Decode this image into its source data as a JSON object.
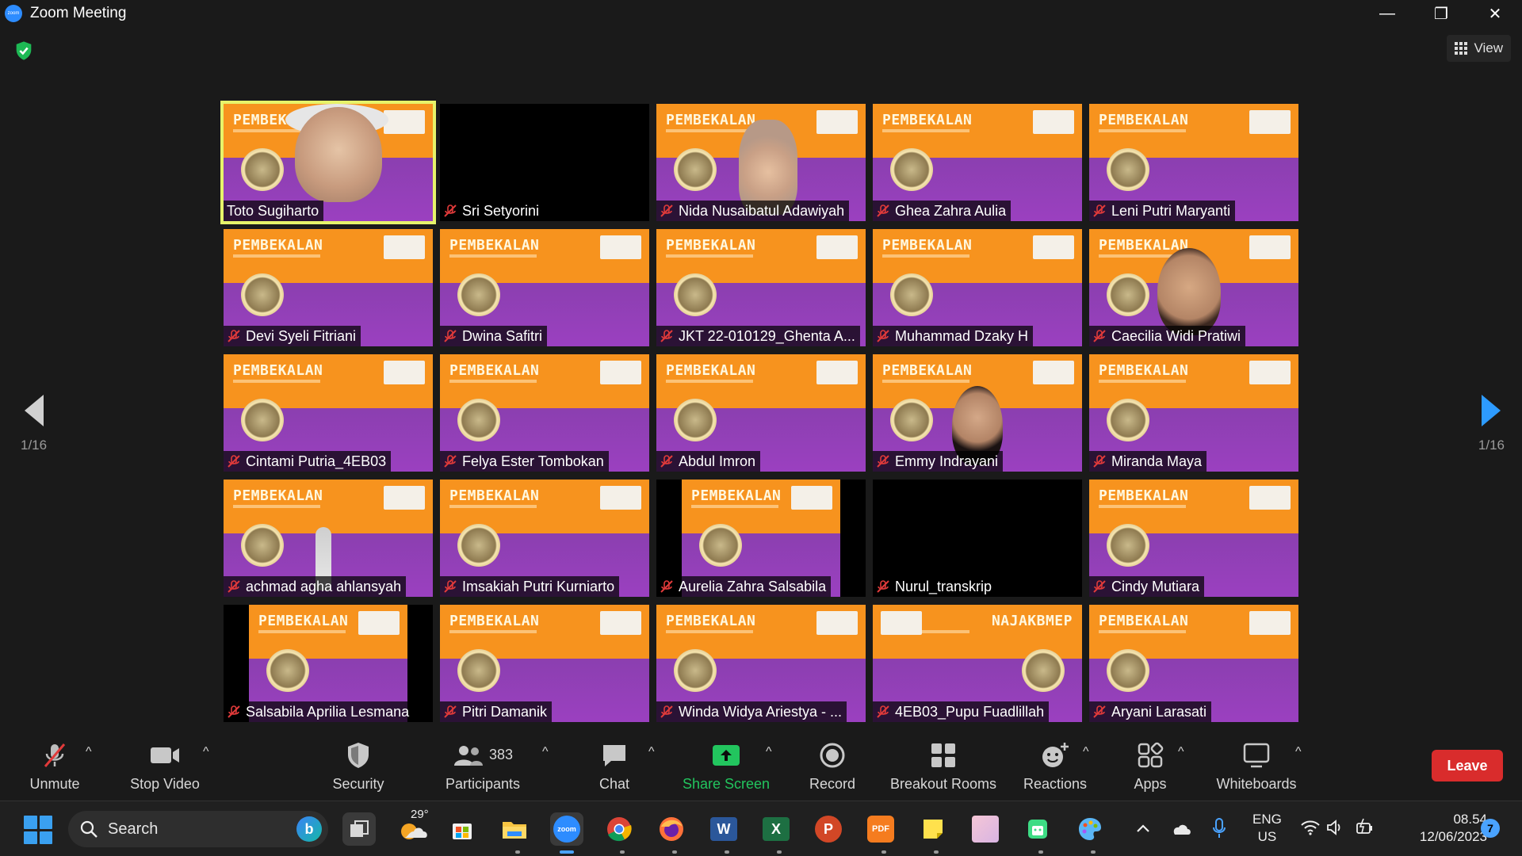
{
  "window": {
    "title": "Zoom Meeting",
    "logo_text": "zoom",
    "minimize": "—",
    "restore": "❐",
    "close": "✕"
  },
  "top": {
    "view_label": "View"
  },
  "slide": {
    "title": "PEMBEKALAN",
    "title_mirrored": "NAJAKBMEP"
  },
  "participants_grid": [
    {
      "name": "Toto Sugiharto",
      "muted": false
    },
    {
      "name": "Sri Setyorini",
      "muted": true
    },
    {
      "name": "Nida Nusaibatul Adawiyah",
      "muted": true
    },
    {
      "name": "Ghea Zahra Aulia",
      "muted": true
    },
    {
      "name": "Leni Putri Maryanti",
      "muted": true
    },
    {
      "name": "Devi Syeli Fitriani",
      "muted": true
    },
    {
      "name": "Dwina Safitri",
      "muted": true
    },
    {
      "name": "JKT 22-010129_Ghenta A...",
      "muted": true
    },
    {
      "name": "Muhammad Dzaky H",
      "muted": true
    },
    {
      "name": "Caecilia Widi Pratiwi",
      "muted": true
    },
    {
      "name": "Cintami Putria_4EB03",
      "muted": true
    },
    {
      "name": "Felya Ester Tombokan",
      "muted": true
    },
    {
      "name": "Abdul Imron",
      "muted": true
    },
    {
      "name": "Emmy Indrayani",
      "muted": true
    },
    {
      "name": "Miranda Maya",
      "muted": true
    },
    {
      "name": "achmad agha ahlansyah",
      "muted": true
    },
    {
      "name": "Imsakiah Putri Kurniarto",
      "muted": true
    },
    {
      "name": "Aurelia Zahra Salsabila",
      "muted": true
    },
    {
      "name": "Nurul_transkrip",
      "muted": true
    },
    {
      "name": "Cindy Mutiara",
      "muted": true
    },
    {
      "name": "Salsabila Aprilia Lesmana",
      "muted": true
    },
    {
      "name": "Pitri Damanik",
      "muted": true
    },
    {
      "name": "Winda Widya Ariestya - ...",
      "muted": true
    },
    {
      "name": "4EB03_Pupu Fuadlillah",
      "muted": true
    },
    {
      "name": "Aryani Larasati",
      "muted": true
    }
  ],
  "pagination": {
    "left_label": "1/16",
    "right_label": "1/16"
  },
  "toolbar": {
    "unmute": "Unmute",
    "stop_video": "Stop Video",
    "security": "Security",
    "participants": "Participants",
    "participants_count": "383",
    "chat": "Chat",
    "share_screen": "Share Screen",
    "record": "Record",
    "breakout_rooms": "Breakout Rooms",
    "reactions": "Reactions",
    "apps": "Apps",
    "whiteboards": "Whiteboards",
    "leave": "Leave",
    "caret": "^"
  },
  "taskbar": {
    "search_label": "Search",
    "bing_label": "b",
    "weather_temp": "29°",
    "zoom_label": "zoom",
    "word_label": "W",
    "excel_label": "X",
    "ppt_label": "P",
    "pdf_label": "PDF",
    "lang_line1": "ENG",
    "lang_line2": "US",
    "time": "08.54",
    "date": "12/06/2023",
    "notification_count": "7"
  },
  "colors": {
    "active_speaker_border": "#e7f36a",
    "share_green": "#22c55e",
    "leave_red": "#d92c2c",
    "muted_red": "#e03a3a",
    "slide_orange": "#f7931e",
    "slide_purple": "#8b3fb0"
  }
}
